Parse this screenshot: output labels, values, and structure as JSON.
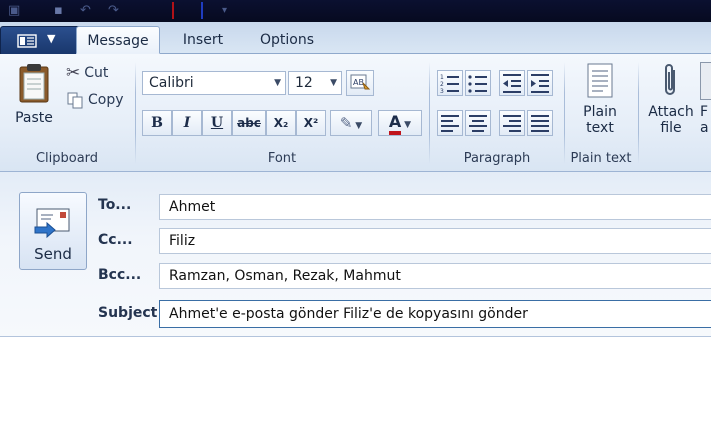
{
  "tabs": {
    "message": "Message",
    "insert": "Insert",
    "options": "Options"
  },
  "ribbon": {
    "clipboard": {
      "paste": "Paste",
      "cut": "Cut",
      "copy": "Copy",
      "group": "Clipboard"
    },
    "font": {
      "family": "Calibri",
      "size": "12",
      "bold": "B",
      "italic": "I",
      "underline": "U",
      "strike": "abc",
      "subscript": "X₂",
      "superscript": "X²",
      "color_letter": "A",
      "group": "Font"
    },
    "paragraph": {
      "group": "Paragraph"
    },
    "plain_text": {
      "button_line1": "Plain",
      "button_line2": "text",
      "group": "Plain text"
    },
    "attach": {
      "line1": "Attach",
      "line2": "file"
    },
    "cut_off": {
      "line1": "F",
      "line2": "a"
    }
  },
  "compose": {
    "send": "Send",
    "to_label": "To...",
    "to_value": "Ahmet",
    "cc_label": "Cc...",
    "cc_value": "Filiz",
    "bcc_label": "Bcc...",
    "bcc_value": "Ramzan, Osman, Rezak, Mahmut",
    "subject_label": "Subject",
    "subject_value": "Ahmet'e e-posta gönder Filiz'e de kopyasını gönder"
  },
  "colors": {
    "ribbon_top": "#f4f8fd",
    "ribbon_bottom": "#d9e5f3",
    "app_menu": "#2b4f8e",
    "title_strip": "#0b1030",
    "font_color_bar": "#c0141c"
  }
}
